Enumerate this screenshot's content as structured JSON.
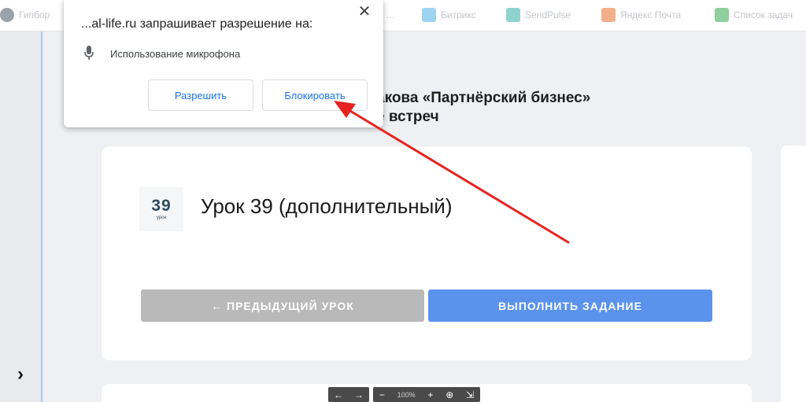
{
  "bookmarks": [
    {
      "label": "Гипбор",
      "color": "#9aa3ab"
    },
    {
      "label": "…",
      "color": "#d8dbe0"
    },
    {
      "label": "Битрикс",
      "color": "#9fd3f2"
    },
    {
      "label": "SendPulse",
      "color": "#8fd3cf"
    },
    {
      "label": "Яндекс Почта",
      "color": "#f2b08a"
    },
    {
      "label": "Список задач",
      "color": "#8fcf9e"
    }
  ],
  "course": {
    "title_fragment": "акова «Партнёрский бизнес»",
    "subtitle_fragment": "е встреч"
  },
  "lesson": {
    "thumb_number": "39",
    "thumb_word": "урок",
    "title": "Урок 39 (дополнительный)",
    "prev_button": "← ПРЕДЫДУЩИЙ УРОК",
    "task_button": "ВЫПОЛНИТЬ ЗАДАНИЕ"
  },
  "sidebar": {
    "toggle_glyph": "›"
  },
  "viewer": {
    "back": "←",
    "forward": "→",
    "zoom_out": "−",
    "zoom_level": "100%",
    "zoom_in": "+",
    "fit": "⊕",
    "expand": "⇲"
  },
  "popup": {
    "close_glyph": "✕",
    "title": "...al-life.ru запрашивает разрешение на:",
    "permission": "Использование микрофона",
    "allow_label": "Разрешить",
    "block_label": "Блокировать"
  },
  "colors": {
    "accent_blue": "#5b93ec",
    "disabled_gray": "#b9b9b9",
    "link_blue": "#1a73e8",
    "arrow_red": "#e8231f"
  }
}
